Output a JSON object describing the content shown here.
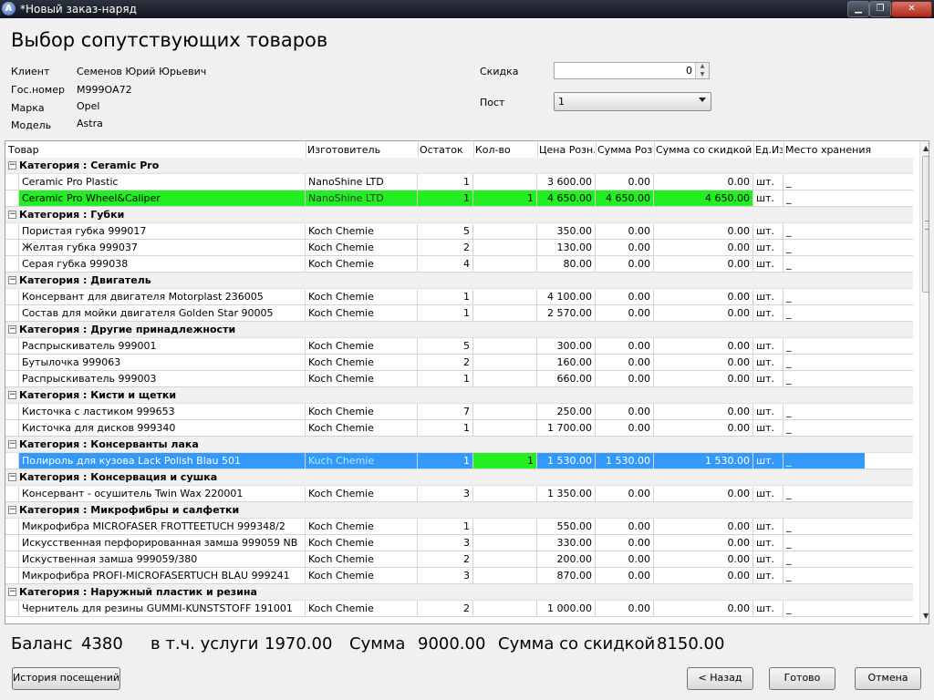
{
  "window": {
    "title": "*Новый заказ-наряд",
    "app_icon_letter": "A"
  },
  "page_title": "Выбор сопутствующих товаров",
  "info": {
    "client_label": "Клиент",
    "client_value": "Семенов Юрий Юрьевич",
    "plate_label": "Гос.номер",
    "plate_value": "М999ОА72",
    "brand_label": "Марка",
    "brand_value": "Opel",
    "model_label": "Модель",
    "model_value": "Astra",
    "discount_label": "Скидка",
    "discount_value": "0",
    "post_label": "Пост",
    "post_value": "1"
  },
  "columns": [
    "Товар",
    "Изготовитель",
    "Остаток",
    "Кол-во",
    "Цена Розн.",
    "Сумма Розн",
    "Сумма со скидкой",
    "Ед.Из",
    "Место хранения"
  ],
  "groups": [
    {
      "category": "Категория : Ceramic Pro",
      "items": [
        {
          "name": "Ceramic Pro Plastic",
          "maker": "NanoShine LTD",
          "stock": "1",
          "qty": "",
          "price": "3 600.00",
          "sum": "0.00",
          "disc": "0.00",
          "unit": "шт.",
          "place": "_"
        },
        {
          "name": "Ceramic Pro Wheel&Caliper",
          "maker": "NanoShine LTD",
          "stock": "1",
          "qty": "1",
          "price": "4 650.00",
          "sum": "4 650.00",
          "disc": "4 650.00",
          "unit": "шт.",
          "place": "_",
          "highlight": "green"
        }
      ]
    },
    {
      "category": "Категория : Губки",
      "items": [
        {
          "name": "Пористая губка 999017",
          "maker": "Koch Chemie",
          "stock": "5",
          "qty": "",
          "price": "350.00",
          "sum": "0.00",
          "disc": "0.00",
          "unit": "шт.",
          "place": "_"
        },
        {
          "name": "Желтая губка 999037",
          "maker": "Koch Chemie",
          "stock": "2",
          "qty": "",
          "price": "130.00",
          "sum": "0.00",
          "disc": "0.00",
          "unit": "шт.",
          "place": "_"
        },
        {
          "name": " Серая губка 999038",
          "maker": "Koch Chemie",
          "stock": "4",
          "qty": "",
          "price": "80.00",
          "sum": "0.00",
          "disc": "0.00",
          "unit": "шт.",
          "place": "_"
        }
      ]
    },
    {
      "category": "Категория : Двигатель",
      "items": [
        {
          "name": " Консервант для двигателя Motorplast  236005",
          "maker": "Koch Chemie",
          "stock": "1",
          "qty": "",
          "price": "4 100.00",
          "sum": "0.00",
          "disc": "0.00",
          "unit": "шт.",
          "place": "_"
        },
        {
          "name": "Состав для мойки двигателя Golden Star 90005",
          "maker": "Koch Chemie",
          "stock": "1",
          "qty": "",
          "price": "2 570.00",
          "sum": "0.00",
          "disc": "0.00",
          "unit": "шт.",
          "place": "_"
        }
      ]
    },
    {
      "category": "Категория : Другие принадлежности",
      "items": [
        {
          "name": "Распрыскиватель 999001",
          "maker": "Koch Chemie",
          "stock": "5",
          "qty": "",
          "price": "300.00",
          "sum": "0.00",
          "disc": "0.00",
          "unit": "шт.",
          "place": "_"
        },
        {
          "name": "Бутылочка 999063",
          "maker": "Koch Chemie",
          "stock": "2",
          "qty": "",
          "price": "160.00",
          "sum": "0.00",
          "disc": "0.00",
          "unit": "шт.",
          "place": "_"
        },
        {
          "name": " Распрыскиватель 999003",
          "maker": "Koch Chemie",
          "stock": "1",
          "qty": "",
          "price": "660.00",
          "sum": "0.00",
          "disc": "0.00",
          "unit": "шт.",
          "place": "_"
        }
      ]
    },
    {
      "category": "Категория : Кисти и щетки",
      "items": [
        {
          "name": "Кисточка с ластиком 999653",
          "maker": "Koch Chemie",
          "stock": "7",
          "qty": "",
          "price": "250.00",
          "sum": "0.00",
          "disc": "0.00",
          "unit": "шт.",
          "place": "_"
        },
        {
          "name": "Кисточка для дисков 999340",
          "maker": "Koch Chemie",
          "stock": "1",
          "qty": "",
          "price": "1 700.00",
          "sum": "0.00",
          "disc": "0.00",
          "unit": "шт.",
          "place": "_"
        }
      ]
    },
    {
      "category": "Категория : Консерванты лака",
      "items": [
        {
          "name": "Полироль для кузова Lack Polish Blau 501",
          "maker": "Kuch Chemie",
          "stock": "1",
          "qty": "1",
          "price": "1 530.00",
          "sum": "1 530.00",
          "disc": "1 530.00",
          "unit": "шт.",
          "place": "_",
          "highlight": "blue"
        }
      ]
    },
    {
      "category": "Категория : Консервация и сушка",
      "items": [
        {
          "name": "Консервант - осушитель Twin Wax 220001",
          "maker": "Koch Chemie",
          "stock": "3",
          "qty": "",
          "price": "1 350.00",
          "sum": "0.00",
          "disc": "0.00",
          "unit": "шт.",
          "place": "_"
        }
      ]
    },
    {
      "category": "Категория : Микрофибры и салфетки",
      "items": [
        {
          "name": "Микрофибра MICROFASER FROTTEETUCH 999348/2",
          "maker": "Koch Chemie",
          "stock": "1",
          "qty": "",
          "price": "550.00",
          "sum": "0.00",
          "disc": "0.00",
          "unit": "шт.",
          "place": "_"
        },
        {
          "name": " Искусственная перфорированная замша 999059 NB",
          "maker": "Koch Chemie",
          "stock": "3",
          "qty": "",
          "price": "330.00",
          "sum": "0.00",
          "disc": "0.00",
          "unit": "шт.",
          "place": "_"
        },
        {
          "name": "Искуственная замша 999059/380",
          "maker": "Koch Chemie",
          "stock": "2",
          "qty": "",
          "price": "200.00",
          "sum": "0.00",
          "disc": "0.00",
          "unit": "шт.",
          "place": "_"
        },
        {
          "name": "Микрофибра PROFI-MICROFASERTUCH BLAU 999241",
          "maker": "Koch Chemie",
          "stock": "3",
          "qty": "",
          "price": "870.00",
          "sum": "0.00",
          "disc": "0.00",
          "unit": "шт.",
          "place": "_"
        }
      ]
    },
    {
      "category": "Категория : Наружный пластик и резина",
      "items": [
        {
          "name": "Чернитель для резины GUMMI-KUNSTSTOFF 191001",
          "maker": "Koch Chemie",
          "stock": "2",
          "qty": "",
          "price": "1 000.00",
          "sum": "0.00",
          "disc": "0.00",
          "unit": "шт.",
          "place": "_"
        }
      ]
    }
  ],
  "totals": {
    "balance_label": "Баланс",
    "balance_value": "4380",
    "services_label": "в т.ч. услуги",
    "services_value": "1970.00",
    "sum_label": "Сумма",
    "sum_value": "9000.00",
    "discount_sum_label": "Сумма со скидкой",
    "discount_sum_value": "8150.00"
  },
  "buttons": {
    "history": "История посещений",
    "back": "< Назад",
    "done": "Готово",
    "cancel": "Отмена"
  },
  "colors": {
    "selected_row": "#3399ff",
    "edited_row": "#22ee22"
  },
  "icons": {
    "app": "app-logo-icon",
    "minimize": "minimize-icon",
    "maximize": "maximize-icon",
    "close": "close-icon",
    "expand": "collapse-minus-icon",
    "dropdown": "chevron-down-icon"
  }
}
